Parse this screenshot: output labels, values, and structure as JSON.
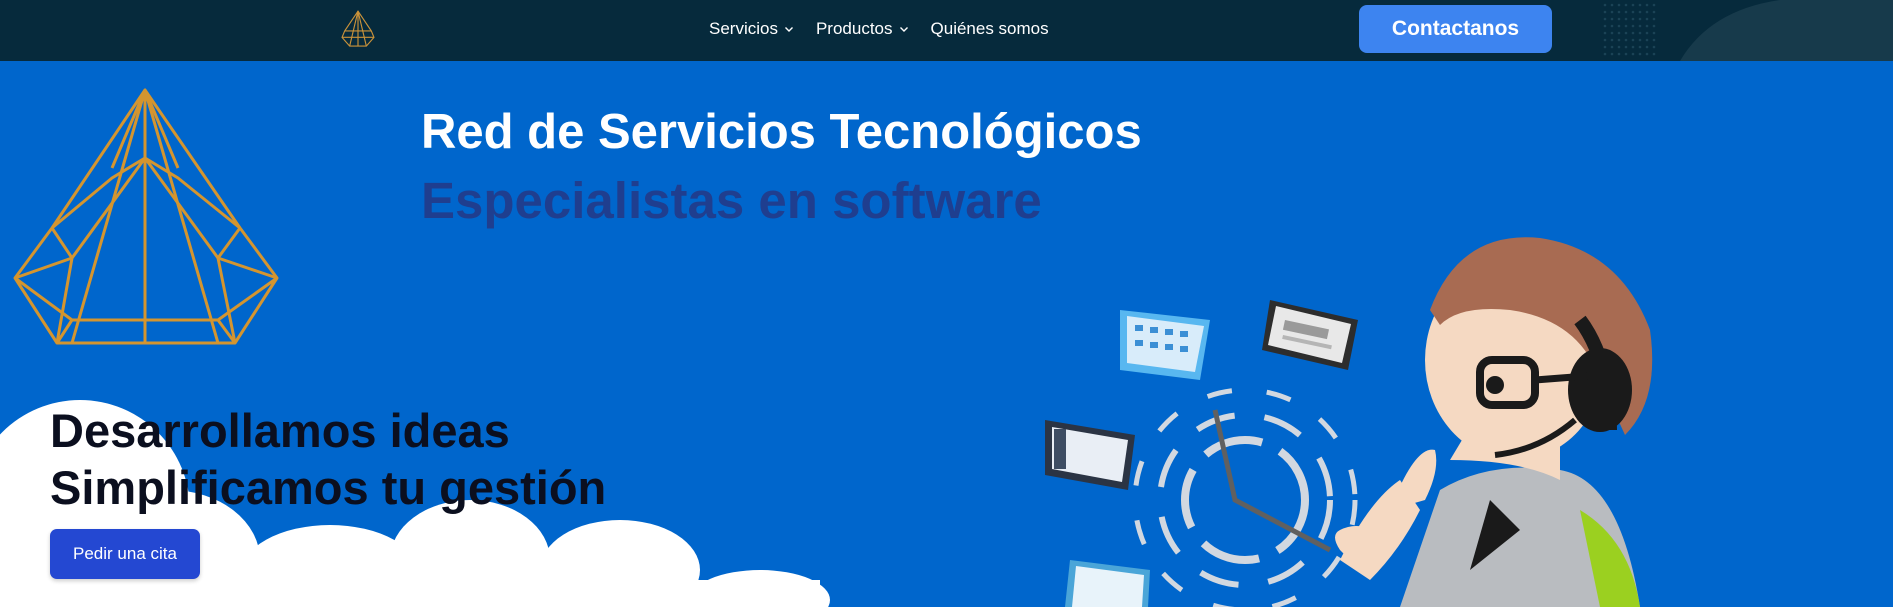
{
  "nav": {
    "items": [
      {
        "label": "Servicios",
        "has_dropdown": true
      },
      {
        "label": "Productos",
        "has_dropdown": true
      },
      {
        "label": "Quiénes somos",
        "has_dropdown": false
      }
    ],
    "cta_label": "Contactanos"
  },
  "hero": {
    "title": "Red de Servicios Tecnológicos",
    "subtitle": "Especialistas en software",
    "tagline_line1": "Desarrollamos ideas",
    "tagline_line2": "Simplificamos tu gestión",
    "cta_label": "Pedir una cita"
  },
  "colors": {
    "navbar_bg": "#062a3c",
    "hero_bg": "#0066cc",
    "cta_top": "#3d84f0",
    "cta_hero": "#2448d2",
    "logo_gold": "#d4952f",
    "subtitle": "#1f3e8f"
  },
  "icons": {
    "logo": "diamond-logo-icon",
    "dropdown": "chevron-down-icon"
  }
}
